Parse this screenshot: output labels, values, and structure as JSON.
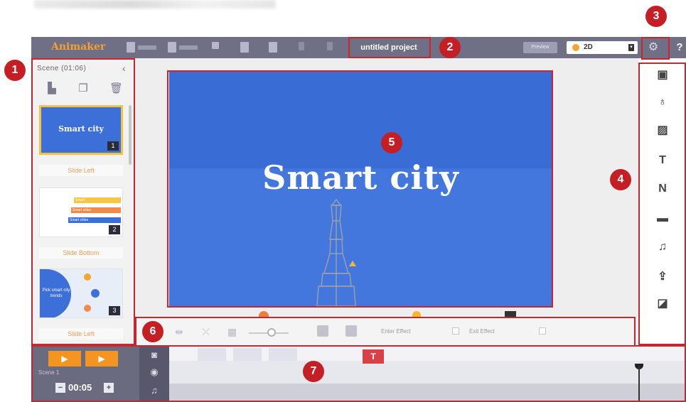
{
  "app": {
    "logo": "Animaker",
    "project_title": "untitled project",
    "preview_label": "Preview",
    "mode_value": "2D"
  },
  "scenes_panel": {
    "header": "Scene (01:06)",
    "scenes": [
      {
        "title": "Smart city",
        "number": "1",
        "transition": "Slide Left"
      },
      {
        "number": "2",
        "transition": "Slide Bottom",
        "bars": [
          "Smart",
          "Smart cities",
          "Smart cities"
        ]
      },
      {
        "title": "Pick smart city trends",
        "number": "3",
        "transition": "Slide Left"
      }
    ]
  },
  "canvas": {
    "title": "Smart city",
    "background": "#3a6cd6"
  },
  "property_bar": {
    "enter_effect": "Enter Effect",
    "exit_effect": "Exit Effect"
  },
  "library": {
    "icons": [
      "character-icon",
      "property-icon",
      "image-icon",
      "text-icon",
      "number-icon",
      "video-icon",
      "music-icon",
      "upload-icon",
      "background-icon"
    ],
    "text_glyph": "T",
    "number_glyph": "N"
  },
  "timeline": {
    "scene_label": "Scene 1",
    "duration": "00:05",
    "text_marker": "T"
  },
  "annotations": [
    "1",
    "2",
    "3",
    "4",
    "5",
    "6",
    "7"
  ],
  "colors": {
    "accent": "#f49422",
    "highlight": "#c8262d",
    "toolbar": "#6f6f85",
    "scene_blue": "#3c6fd8"
  }
}
